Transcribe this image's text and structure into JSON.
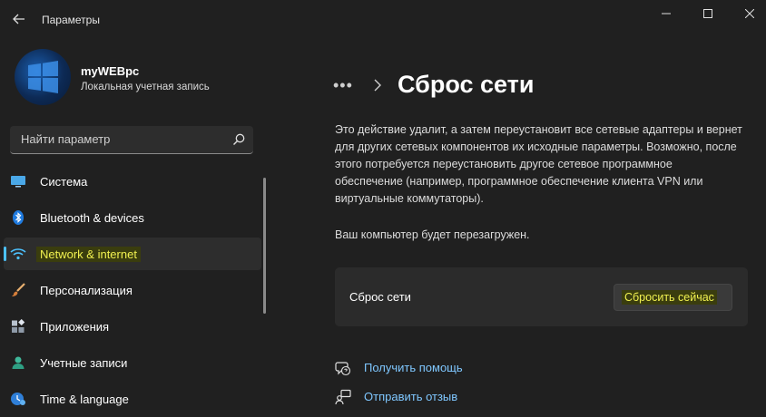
{
  "window": {
    "title": "Параметры"
  },
  "profile": {
    "name": "myWEBpc",
    "account_type": "Локальная учетная запись"
  },
  "search": {
    "placeholder": "Найти параметр"
  },
  "sidebar": {
    "items": [
      {
        "label": "Система",
        "icon": "system-display-icon"
      },
      {
        "label": "Bluetooth & devices",
        "icon": "bluetooth-icon"
      },
      {
        "label": "Network & internet",
        "icon": "wifi-icon",
        "active": true
      },
      {
        "label": "Персонализация",
        "icon": "brush-icon"
      },
      {
        "label": "Приложения",
        "icon": "apps-icon"
      },
      {
        "label": "Учетные записи",
        "icon": "accounts-icon"
      },
      {
        "label": "Time & language",
        "icon": "time-language-icon"
      }
    ]
  },
  "main": {
    "breadcrumb_more": "•••",
    "title": "Сброс сети",
    "description": "Это действие удалит, а затем переустановит все сетевые адаптеры и вернет для других сетевых компонентов их исходные параметры. Возможно, после этого потребуется переустановить другое сетевое программное обеспечение (например, программное обеспечение клиента VPN или виртуальные коммутаторы).",
    "reboot_note": "Ваш компьютер будет перезагружен.",
    "card": {
      "label": "Сброс сети",
      "button": "Сбросить сейчас"
    },
    "links": [
      {
        "label": "Получить помощь",
        "icon": "help-icon"
      },
      {
        "label": "Отправить отзыв",
        "icon": "feedback-icon"
      }
    ]
  },
  "colors": {
    "background": "#202020",
    "accent": "#4cc2ff",
    "link": "#7fc7ff",
    "highlight_text": "#f0f050"
  }
}
